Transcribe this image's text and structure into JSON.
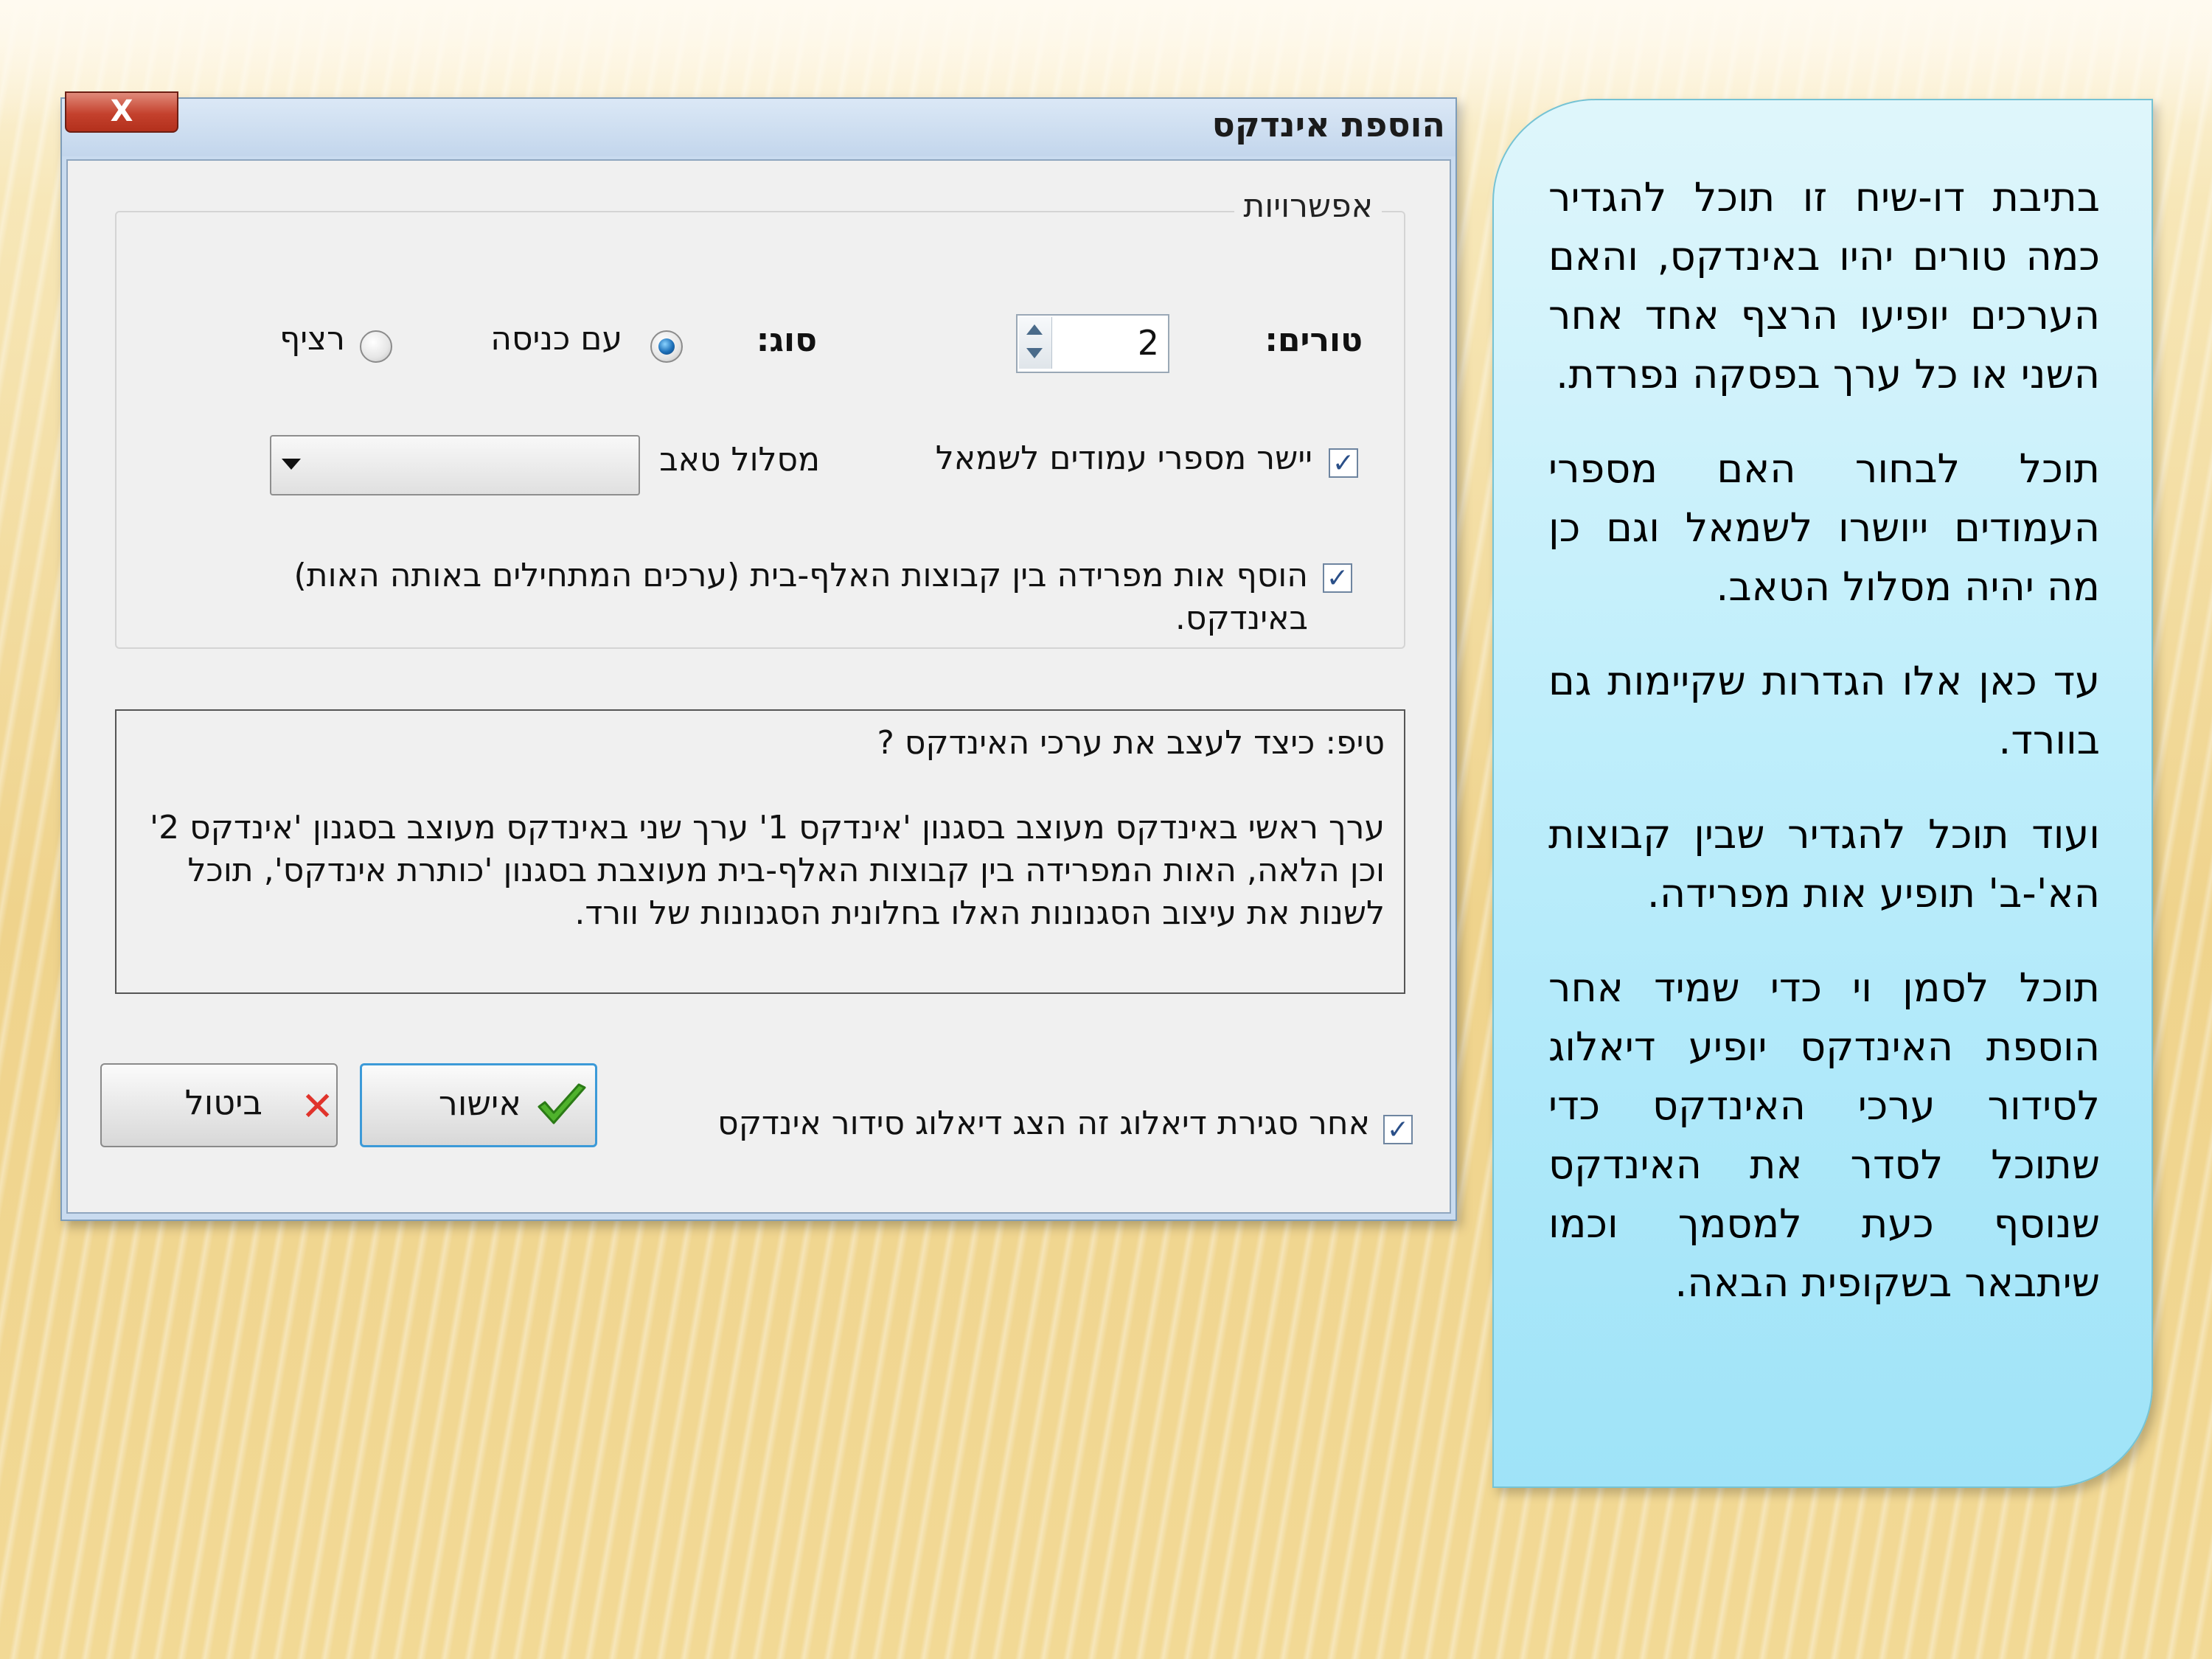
{
  "dialog": {
    "title": "הוספת אינדקס",
    "close_label": "X",
    "options_group": "אפשרויות",
    "columns_label": "טורים:",
    "columns_value": "2",
    "type_label": "סוג:",
    "type_indented": "עם כניסה",
    "type_runin": "רציף",
    "align_right_label": "יישר מספרי עמודים לשמאל",
    "tab_leader_label": "מסלול טאב",
    "tab_leader_value": "",
    "separator_label": "הוסף אות מפרידה בין קבוצות האלף-בית (ערכים המתחילים באותה האות) באינדקס.",
    "tip_title": "טיפ: כיצד לעצב את ערכי האינדקס ?",
    "tip_text": "ערך ראשי באינדקס מעוצב בסגנון 'אינדקס 1' ערך שני באינדקס מעוצב בסגנון 'אינדקס 2' וכן הלאה, האות המפרידה בין קבוצות האלף-בית מעוצבת בסגנון 'כותרת אינדקס', תוכל לשנות את עיצוב הסגנונות האלו בחלונית הסגנונות של וורד.",
    "show_sort_label": "אחר סגירת דיאלוג זה הצג דיאלוג סידור אינדקס",
    "ok_label": "אישור",
    "cancel_label": "ביטול",
    "checkmark": "✓",
    "cancel_mark": "✕"
  },
  "note": {
    "paragraphs": [
      "בתיבת דו-שיח זו תוכל להגדיר כמה טורים יהיו באינדקס, והאם הערכים יופיעו הרצף אחד אחר השני או כל ערך בפסקה נפרדת.",
      "תוכל לבחור האם מספרי העמודים ייושרו לשמאל וגם כן מה יהיה מסלול הטאב.",
      "עד כאן אלו הגדרות שקיימות גם בוורד.",
      "ועוד תוכל להגדיר שבין קבוצות הא'-ב' תופיע אות מפרידה.",
      "תוכל לסמן וי כדי שמיד אחר הוספת האינדקס יופיע דיאלוג לסידור ערכי האינדקס כדי שתוכל לסדר את האינדקס שנוסף כעת למסמך וכמו שיתבאר בשקופית הבאה."
    ]
  },
  "colors": {
    "note_gradient_top": "#dff6fb",
    "note_gradient_bottom": "#9fe3f8",
    "ok_border": "#3c9ad8",
    "cancel_icon": "#e0332b"
  }
}
